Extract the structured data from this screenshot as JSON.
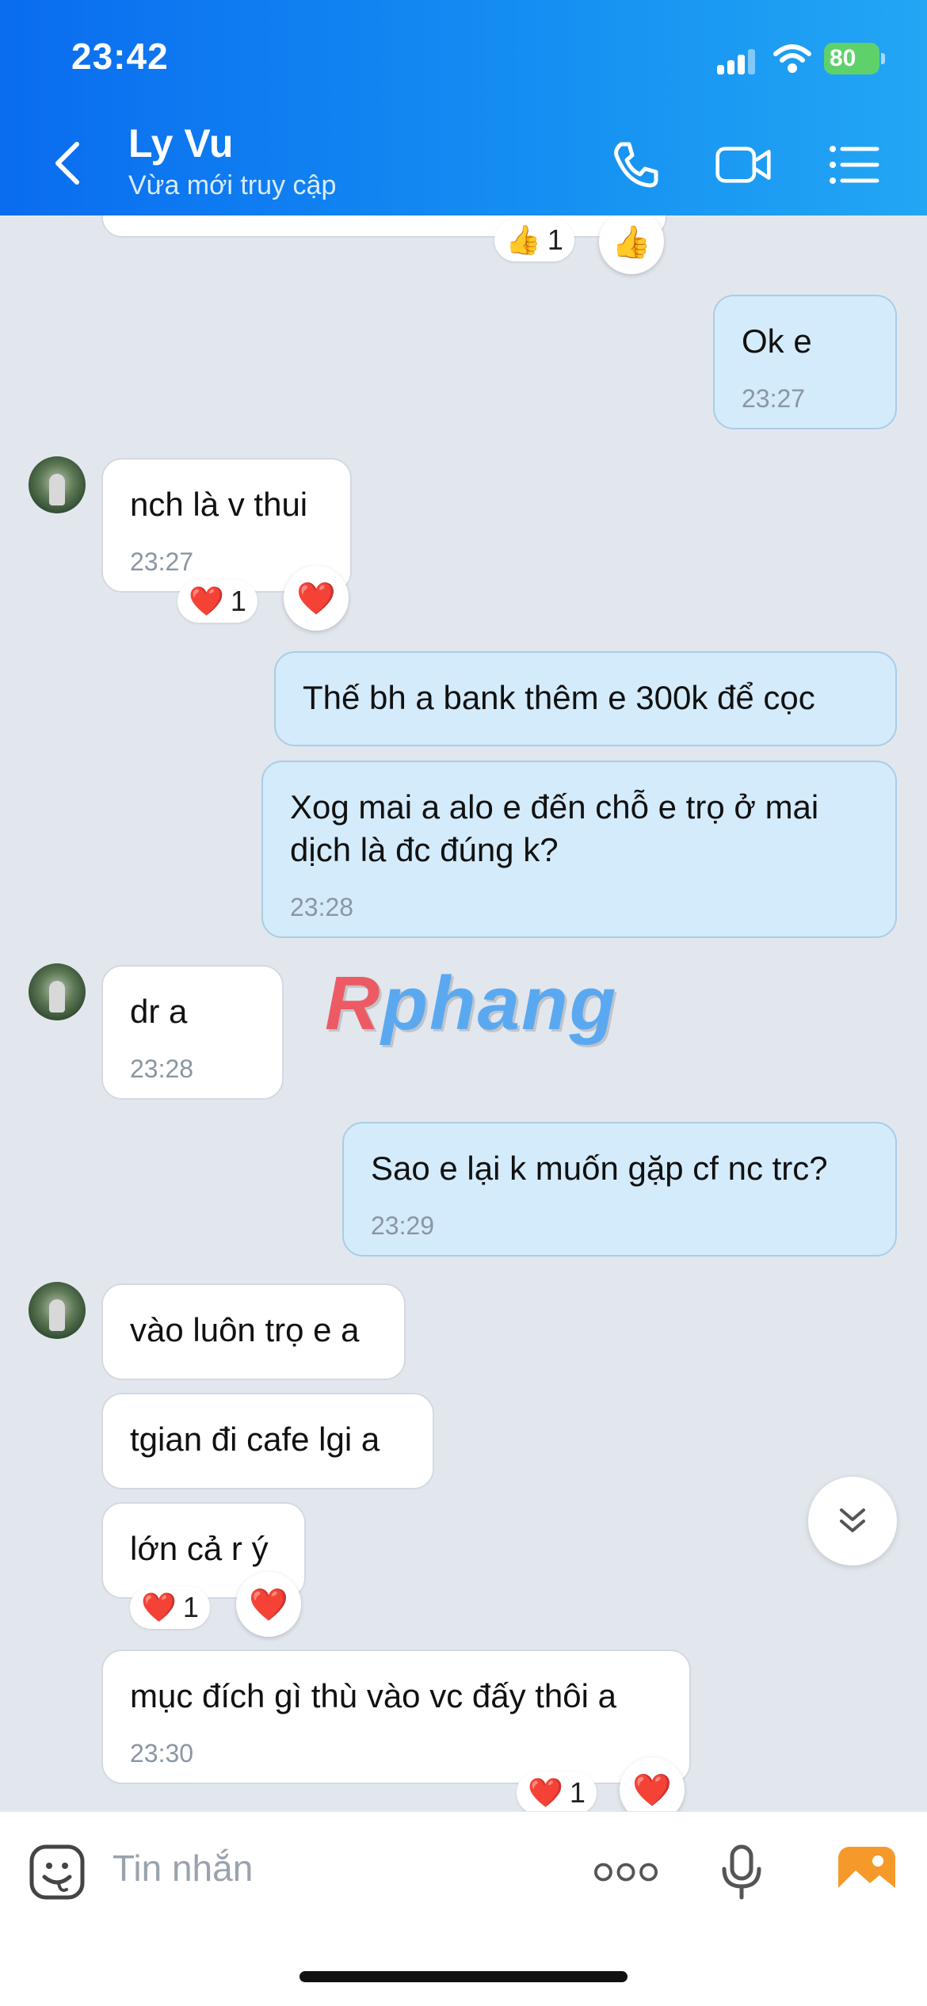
{
  "status_bar": {
    "time": "23:42",
    "battery": "80"
  },
  "header": {
    "contact_name": "Ly Vu",
    "contact_status": "Vừa mới truy cập",
    "icons": [
      "back-icon",
      "phone-icon",
      "video-call-icon",
      "menu-list-icon"
    ]
  },
  "messages": [
    {
      "dir": "out",
      "text": "Ok e",
      "time": "23:27"
    },
    {
      "dir": "in",
      "text": "nch là v thui",
      "time": "23:27",
      "reaction": {
        "emoji": "❤️",
        "count": "1"
      }
    },
    {
      "dir": "out",
      "text": "Thế bh a bank thêm e 300k để cọc"
    },
    {
      "dir": "out",
      "text": "Xog mai a alo e đến chỗ e trọ ở mai dịch là đc đúng k?",
      "time": "23:28"
    },
    {
      "dir": "in",
      "text": "dr a",
      "time": "23:28"
    },
    {
      "dir": "out",
      "text": "Sao e lại k muốn gặp cf nc trc?",
      "time": "23:29"
    },
    {
      "dir": "in",
      "text": "vào luôn trọ e a"
    },
    {
      "dir": "in",
      "text": "tgian đi cafe lgi a"
    },
    {
      "dir": "in",
      "text": "lớn cả r ý",
      "reaction": {
        "emoji": "❤️",
        "count": "1"
      }
    },
    {
      "dir": "in",
      "text": "mục đích gì thù vào vc đấy thôi a",
      "time": "23:30",
      "reaction": {
        "emoji": "❤️",
        "count": "1"
      }
    }
  ],
  "top_reaction": {
    "emoji": "👍",
    "count": "1"
  },
  "watermark": {
    "r": "R",
    "rest": "phang"
  },
  "composer": {
    "placeholder": "Tin nhắn"
  },
  "colors": {
    "header": "#0a6cf0",
    "bubble_out": "#d4ebfb",
    "bubble_in": "#ffffff",
    "chat_bg": "#e2e7ee"
  }
}
